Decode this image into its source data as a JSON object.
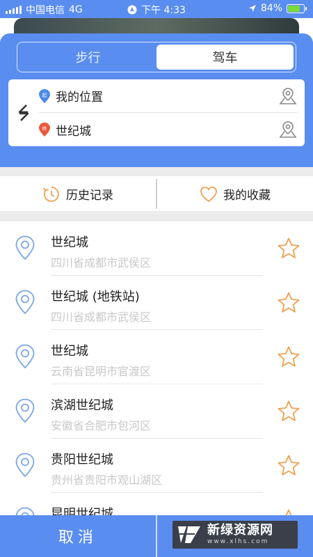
{
  "status_bar": {
    "carrier": "中国电信",
    "network": "4G",
    "time": "下午 4:33",
    "battery": "84%",
    "battery_level": 0.84
  },
  "mode_tabs": [
    {
      "label": "步行",
      "active": false
    },
    {
      "label": "驾车",
      "active": true
    }
  ],
  "route": {
    "start": "我的位置",
    "start_marker": "起",
    "end": "世纪城",
    "end_marker": "终"
  },
  "tabs": {
    "history": "历史记录",
    "favorites": "我的收藏"
  },
  "results": [
    {
      "title": "世纪城",
      "address": "四川省成都市武侯区"
    },
    {
      "title": "世纪城 (地铁站)",
      "address": "四川省成都市武侯区"
    },
    {
      "title": "世纪城",
      "address": "云南省昆明市官渡区"
    },
    {
      "title": "滨湖世纪城",
      "address": "安徽省合肥市包河区"
    },
    {
      "title": "贵阳世纪城",
      "address": "贵州省贵阳市观山湖区"
    },
    {
      "title": "昆明世纪城",
      "address": ""
    }
  ],
  "bottom": {
    "cancel": "取消"
  },
  "watermark": {
    "name": "新绿资源网",
    "url": "www.xlhs.com"
  },
  "colors": {
    "primary": "#5a8df0",
    "star": "#f0a050",
    "pin": "#7aa6e6",
    "start_pin": "#4a8ae8",
    "end_pin": "#e8573c"
  }
}
